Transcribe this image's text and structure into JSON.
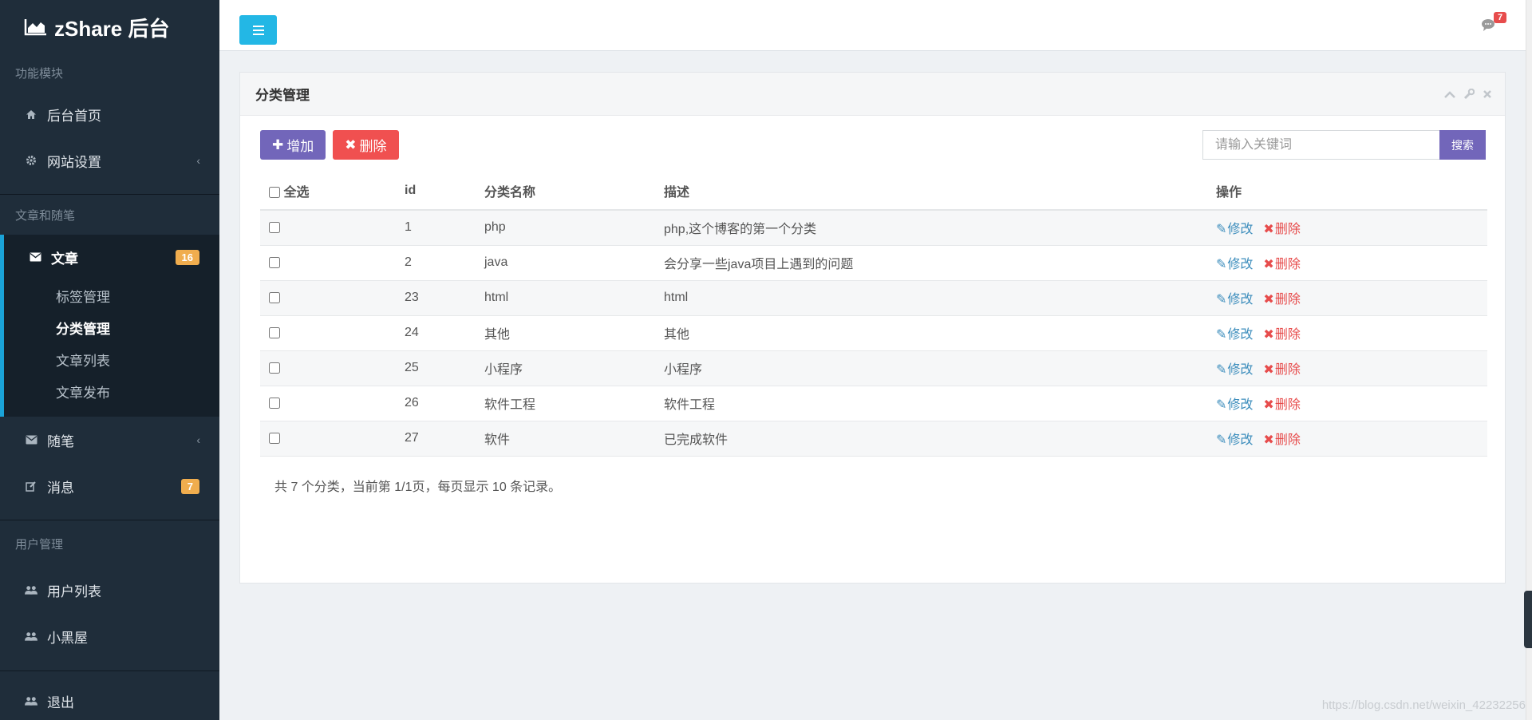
{
  "brand": {
    "name": "zShare 后台"
  },
  "sidebar": {
    "sections": {
      "modules": "功能模块",
      "articles": "文章和随笔",
      "users": "用户管理"
    },
    "items": {
      "home": "后台首页",
      "site_settings": "网站设置",
      "article": "文章",
      "article_badge": "16",
      "tag_manage": "标签管理",
      "category_manage": "分类管理",
      "article_list": "文章列表",
      "article_publish": "文章发布",
      "essay": "随笔",
      "message": "消息",
      "message_badge": "7",
      "user_list": "用户列表",
      "blacklist": "小黑屋",
      "logout": "退出"
    }
  },
  "topbar": {
    "message_count": "7"
  },
  "panel": {
    "title": "分类管理",
    "add_label": "增加",
    "delete_label": "删除",
    "search_placeholder": "请输入关键词",
    "search_label": "搜索"
  },
  "table": {
    "headers": {
      "select_all": "全选",
      "id": "id",
      "name": "分类名称",
      "desc": "描述",
      "ops": "操作"
    },
    "edit_label": "修改",
    "delete_label": "删除",
    "rows": [
      {
        "id": "1",
        "name": "php",
        "desc": "php,这个博客的第一个分类"
      },
      {
        "id": "2",
        "name": "java",
        "desc": "会分享一些java项目上遇到的问题"
      },
      {
        "id": "23",
        "name": "html",
        "desc": "html"
      },
      {
        "id": "24",
        "name": "其他",
        "desc": "其他"
      },
      {
        "id": "25",
        "name": "小程序",
        "desc": "小程序"
      },
      {
        "id": "26",
        "name": "软件工程",
        "desc": "软件工程"
      },
      {
        "id": "27",
        "name": "软件",
        "desc": "已完成软件"
      }
    ]
  },
  "summary": "共 7 个分类，当前第 1/1页，每页显示 10 条记录。",
  "watermark": "https://blog.csdn.net/weixin_42232256",
  "colors": {
    "sidebar_bg": "#1f2d3a",
    "accent_blue": "#23b7e5",
    "purple": "#7266ba",
    "red": "#f05050",
    "badge_orange": "#f0ad4e"
  }
}
